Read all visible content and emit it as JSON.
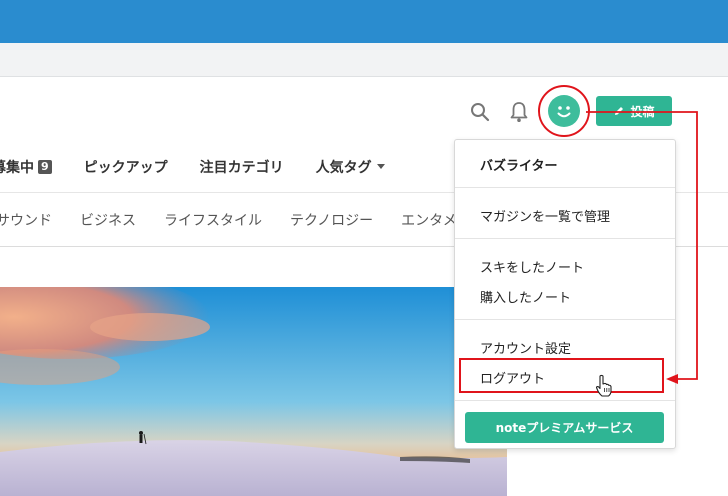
{
  "header": {
    "post_label": "投稿",
    "icons": [
      "search-icon",
      "bell-icon",
      "avatar-smiley-icon",
      "pencil-icon"
    ]
  },
  "nav_primary": [
    {
      "label": "募集中",
      "badge": "9"
    },
    {
      "label": "ピックアップ"
    },
    {
      "label": "注目カテゴリ"
    },
    {
      "label": "人気タグ",
      "icon": "caret-down-icon"
    }
  ],
  "nav_secondary": [
    "サウンド",
    "ビジネス",
    "ライフスタイル",
    "テクノロジー",
    "エンタメ"
  ],
  "menu": {
    "username": "バズライター",
    "items": {
      "magazines": "マガジンを一覧で管理",
      "liked_notes": "スキをしたノート",
      "purchased_notes": "購入したノート",
      "account_settings": "アカウント設定",
      "logout": "ログアウト"
    },
    "premium_button": "noteプレミアムサービス"
  },
  "colors": {
    "topbar": "#2a8ccf",
    "accent": "#2fb594",
    "annotation": "#e0141b"
  }
}
